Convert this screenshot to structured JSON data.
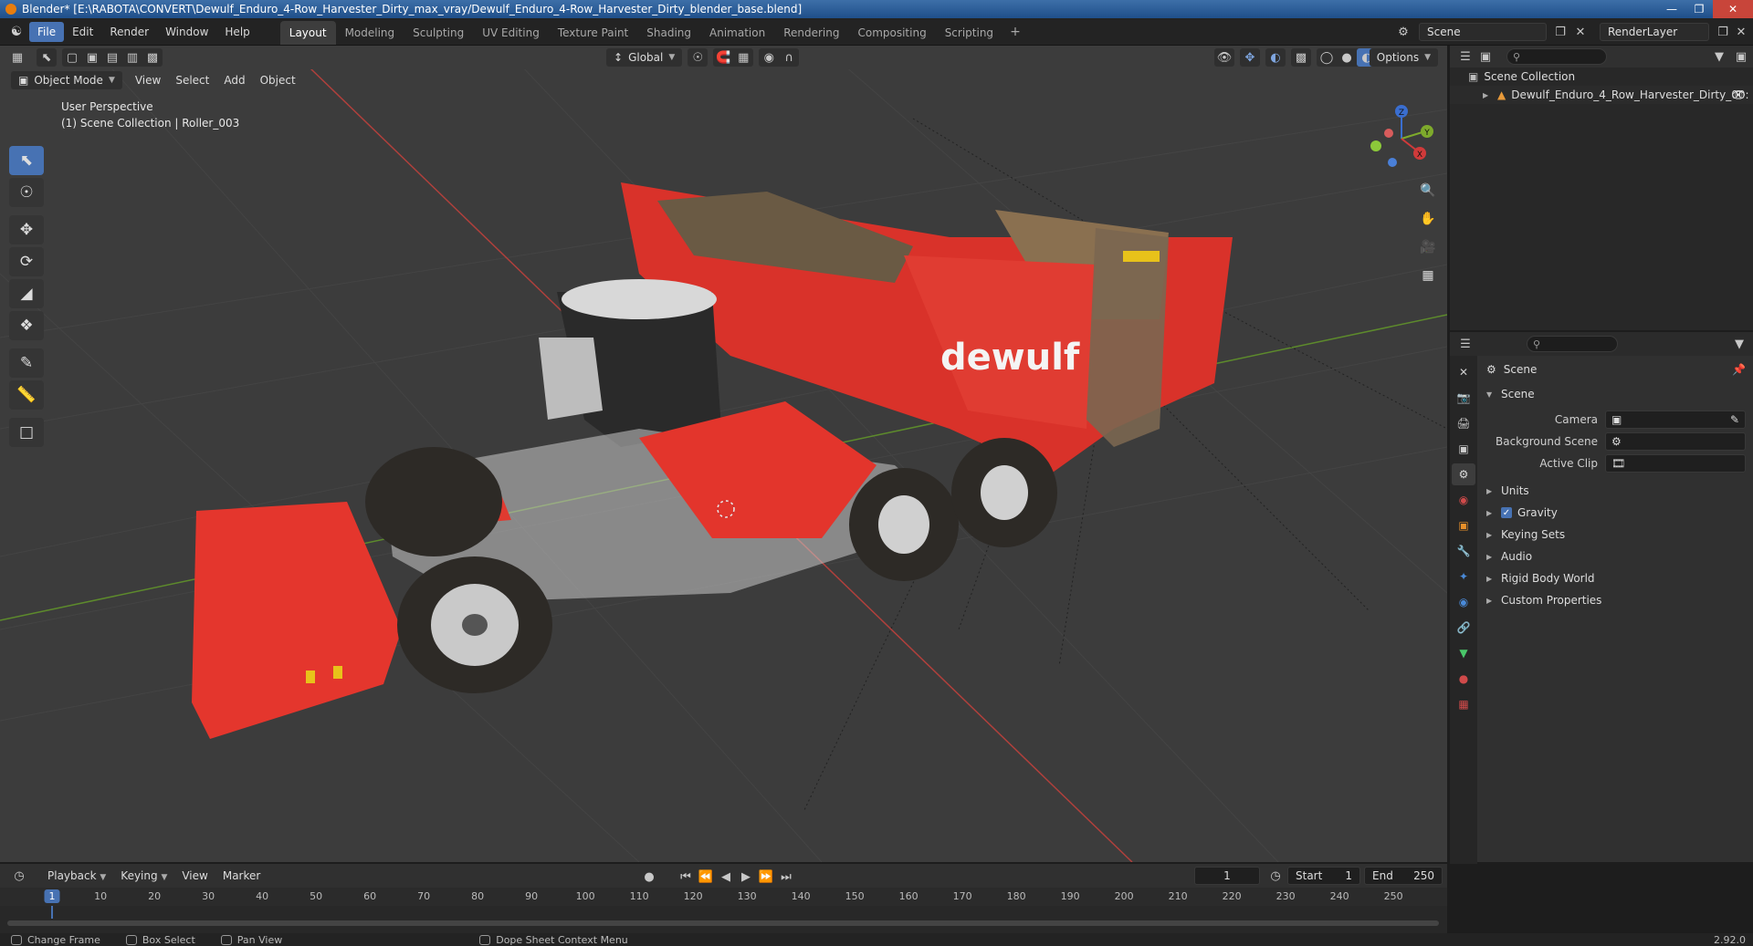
{
  "window": {
    "title": "Blender* [E:\\RABOTA\\CONVERT\\Dewulf_Enduro_4-Row_Harvester_Dirty_max_vray/Dewulf_Enduro_4-Row_Harvester_Dirty_blender_base.blend]"
  },
  "menu": [
    "File",
    "Edit",
    "Render",
    "Window",
    "Help"
  ],
  "workspaces": [
    "Layout",
    "Modeling",
    "Sculpting",
    "UV Editing",
    "Texture Paint",
    "Shading",
    "Animation",
    "Rendering",
    "Compositing",
    "Scripting"
  ],
  "scene_name": "Scene",
  "render_layer": "RenderLayer",
  "viewport": {
    "mode": "Object Mode",
    "menus": [
      "View",
      "Select",
      "Add",
      "Object"
    ],
    "transform_orientation": "Global",
    "options_label": "Options",
    "info_line1": "User Perspective",
    "info_line2": "(1) Scene Collection | Roller_003",
    "model_brand": "dewulf"
  },
  "gizmo": {
    "z": "Z",
    "y": "Y",
    "x": "X"
  },
  "outliner": {
    "root": "Scene Collection",
    "child": "Dewulf_Enduro_4_Row_Harvester_Dirty_00:"
  },
  "properties": {
    "header": "Scene",
    "section": "Scene",
    "fields": [
      {
        "label": "Camera",
        "value": ""
      },
      {
        "label": "Background Scene",
        "value": ""
      },
      {
        "label": "Active Clip",
        "value": ""
      }
    ],
    "panels": [
      "Units",
      "Gravity",
      "Keying Sets",
      "Audio",
      "Rigid Body World",
      "Custom Properties"
    ]
  },
  "timeline": {
    "menus": [
      "Playback",
      "Keying",
      "View",
      "Marker"
    ],
    "current_frame": "1",
    "start_label": "Start",
    "start": "1",
    "end_label": "End",
    "end": "250",
    "ticks": [
      "10",
      "20",
      "30",
      "40",
      "50",
      "60",
      "70",
      "80",
      "90",
      "100",
      "110",
      "120",
      "130",
      "140",
      "150",
      "160",
      "170",
      "180",
      "190",
      "200",
      "210",
      "220",
      "230",
      "240",
      "250"
    ]
  },
  "statusbar": {
    "items": [
      "Change Frame",
      "Box Select",
      "Pan View",
      "Dope Sheet Context Menu"
    ],
    "version": "2.92.0"
  },
  "colors": {
    "accent": "#4772b3",
    "harvester_red": "#e8332a",
    "axis_red": "#c43a3a",
    "axis_green": "#6a9a2a"
  }
}
